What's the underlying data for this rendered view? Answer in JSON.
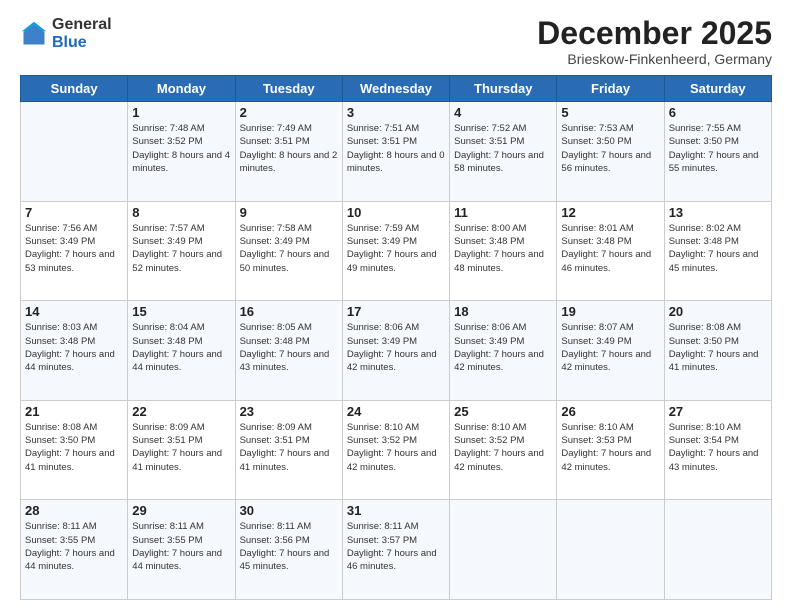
{
  "logo": {
    "general": "General",
    "blue": "Blue"
  },
  "title": "December 2025",
  "location": "Brieskow-Finkenheerd, Germany",
  "days_of_week": [
    "Sunday",
    "Monday",
    "Tuesday",
    "Wednesday",
    "Thursday",
    "Friday",
    "Saturday"
  ],
  "weeks": [
    [
      {
        "day": "",
        "sunrise": "",
        "sunset": "",
        "daylight": ""
      },
      {
        "day": "1",
        "sunrise": "Sunrise: 7:48 AM",
        "sunset": "Sunset: 3:52 PM",
        "daylight": "Daylight: 8 hours and 4 minutes."
      },
      {
        "day": "2",
        "sunrise": "Sunrise: 7:49 AM",
        "sunset": "Sunset: 3:51 PM",
        "daylight": "Daylight: 8 hours and 2 minutes."
      },
      {
        "day": "3",
        "sunrise": "Sunrise: 7:51 AM",
        "sunset": "Sunset: 3:51 PM",
        "daylight": "Daylight: 8 hours and 0 minutes."
      },
      {
        "day": "4",
        "sunrise": "Sunrise: 7:52 AM",
        "sunset": "Sunset: 3:51 PM",
        "daylight": "Daylight: 7 hours and 58 minutes."
      },
      {
        "day": "5",
        "sunrise": "Sunrise: 7:53 AM",
        "sunset": "Sunset: 3:50 PM",
        "daylight": "Daylight: 7 hours and 56 minutes."
      },
      {
        "day": "6",
        "sunrise": "Sunrise: 7:55 AM",
        "sunset": "Sunset: 3:50 PM",
        "daylight": "Daylight: 7 hours and 55 minutes."
      }
    ],
    [
      {
        "day": "7",
        "sunrise": "Sunrise: 7:56 AM",
        "sunset": "Sunset: 3:49 PM",
        "daylight": "Daylight: 7 hours and 53 minutes."
      },
      {
        "day": "8",
        "sunrise": "Sunrise: 7:57 AM",
        "sunset": "Sunset: 3:49 PM",
        "daylight": "Daylight: 7 hours and 52 minutes."
      },
      {
        "day": "9",
        "sunrise": "Sunrise: 7:58 AM",
        "sunset": "Sunset: 3:49 PM",
        "daylight": "Daylight: 7 hours and 50 minutes."
      },
      {
        "day": "10",
        "sunrise": "Sunrise: 7:59 AM",
        "sunset": "Sunset: 3:49 PM",
        "daylight": "Daylight: 7 hours and 49 minutes."
      },
      {
        "day": "11",
        "sunrise": "Sunrise: 8:00 AM",
        "sunset": "Sunset: 3:48 PM",
        "daylight": "Daylight: 7 hours and 48 minutes."
      },
      {
        "day": "12",
        "sunrise": "Sunrise: 8:01 AM",
        "sunset": "Sunset: 3:48 PM",
        "daylight": "Daylight: 7 hours and 46 minutes."
      },
      {
        "day": "13",
        "sunrise": "Sunrise: 8:02 AM",
        "sunset": "Sunset: 3:48 PM",
        "daylight": "Daylight: 7 hours and 45 minutes."
      }
    ],
    [
      {
        "day": "14",
        "sunrise": "Sunrise: 8:03 AM",
        "sunset": "Sunset: 3:48 PM",
        "daylight": "Daylight: 7 hours and 44 minutes."
      },
      {
        "day": "15",
        "sunrise": "Sunrise: 8:04 AM",
        "sunset": "Sunset: 3:48 PM",
        "daylight": "Daylight: 7 hours and 44 minutes."
      },
      {
        "day": "16",
        "sunrise": "Sunrise: 8:05 AM",
        "sunset": "Sunset: 3:48 PM",
        "daylight": "Daylight: 7 hours and 43 minutes."
      },
      {
        "day": "17",
        "sunrise": "Sunrise: 8:06 AM",
        "sunset": "Sunset: 3:49 PM",
        "daylight": "Daylight: 7 hours and 42 minutes."
      },
      {
        "day": "18",
        "sunrise": "Sunrise: 8:06 AM",
        "sunset": "Sunset: 3:49 PM",
        "daylight": "Daylight: 7 hours and 42 minutes."
      },
      {
        "day": "19",
        "sunrise": "Sunrise: 8:07 AM",
        "sunset": "Sunset: 3:49 PM",
        "daylight": "Daylight: 7 hours and 42 minutes."
      },
      {
        "day": "20",
        "sunrise": "Sunrise: 8:08 AM",
        "sunset": "Sunset: 3:50 PM",
        "daylight": "Daylight: 7 hours and 41 minutes."
      }
    ],
    [
      {
        "day": "21",
        "sunrise": "Sunrise: 8:08 AM",
        "sunset": "Sunset: 3:50 PM",
        "daylight": "Daylight: 7 hours and 41 minutes."
      },
      {
        "day": "22",
        "sunrise": "Sunrise: 8:09 AM",
        "sunset": "Sunset: 3:51 PM",
        "daylight": "Daylight: 7 hours and 41 minutes."
      },
      {
        "day": "23",
        "sunrise": "Sunrise: 8:09 AM",
        "sunset": "Sunset: 3:51 PM",
        "daylight": "Daylight: 7 hours and 41 minutes."
      },
      {
        "day": "24",
        "sunrise": "Sunrise: 8:10 AM",
        "sunset": "Sunset: 3:52 PM",
        "daylight": "Daylight: 7 hours and 42 minutes."
      },
      {
        "day": "25",
        "sunrise": "Sunrise: 8:10 AM",
        "sunset": "Sunset: 3:52 PM",
        "daylight": "Daylight: 7 hours and 42 minutes."
      },
      {
        "day": "26",
        "sunrise": "Sunrise: 8:10 AM",
        "sunset": "Sunset: 3:53 PM",
        "daylight": "Daylight: 7 hours and 42 minutes."
      },
      {
        "day": "27",
        "sunrise": "Sunrise: 8:10 AM",
        "sunset": "Sunset: 3:54 PM",
        "daylight": "Daylight: 7 hours and 43 minutes."
      }
    ],
    [
      {
        "day": "28",
        "sunrise": "Sunrise: 8:11 AM",
        "sunset": "Sunset: 3:55 PM",
        "daylight": "Daylight: 7 hours and 44 minutes."
      },
      {
        "day": "29",
        "sunrise": "Sunrise: 8:11 AM",
        "sunset": "Sunset: 3:55 PM",
        "daylight": "Daylight: 7 hours and 44 minutes."
      },
      {
        "day": "30",
        "sunrise": "Sunrise: 8:11 AM",
        "sunset": "Sunset: 3:56 PM",
        "daylight": "Daylight: 7 hours and 45 minutes."
      },
      {
        "day": "31",
        "sunrise": "Sunrise: 8:11 AM",
        "sunset": "Sunset: 3:57 PM",
        "daylight": "Daylight: 7 hours and 46 minutes."
      },
      {
        "day": "",
        "sunrise": "",
        "sunset": "",
        "daylight": ""
      },
      {
        "day": "",
        "sunrise": "",
        "sunset": "",
        "daylight": ""
      },
      {
        "day": "",
        "sunrise": "",
        "sunset": "",
        "daylight": ""
      }
    ]
  ]
}
